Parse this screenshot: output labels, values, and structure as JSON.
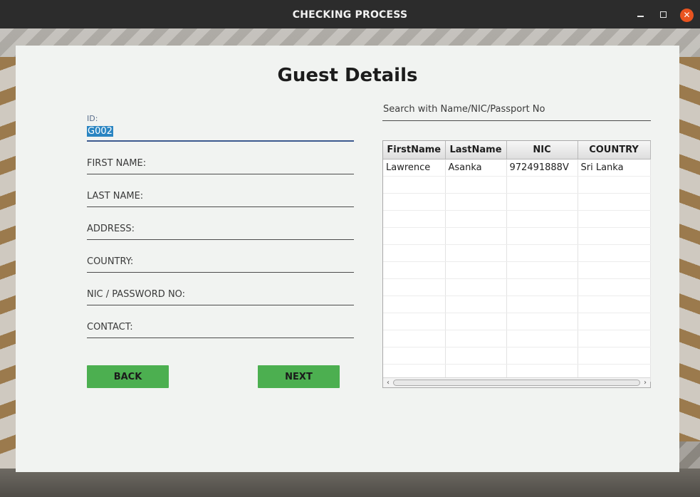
{
  "window": {
    "title": "CHECKING PROCESS",
    "close_glyph": "✕"
  },
  "page": {
    "heading": "Guest Details"
  },
  "form": {
    "id_label": "ID:",
    "id_value": "G002",
    "first_name_label": "FIRST NAME:",
    "last_name_label": "LAST NAME:",
    "address_label": "ADDRESS:",
    "country_label": "COUNTRY:",
    "nic_label": "NIC / PASSWORD NO:",
    "contact_label": "CONTACT:"
  },
  "buttons": {
    "back": "BACK",
    "next": "NEXT"
  },
  "search": {
    "placeholder": "Search  with Name/NIC/Passport No"
  },
  "table": {
    "headers": [
      "FirstName",
      "LastName",
      "NIC",
      "COUNTRY"
    ],
    "rows": [
      [
        "Lawrence",
        "Asanka",
        "972491888V",
        "Sri Lanka"
      ]
    ]
  },
  "icons": {
    "minimize": "minimize-icon",
    "maximize": "maximize-icon",
    "close": "close-icon",
    "scroll_left": "chevron-left-icon",
    "scroll_right": "chevron-right-icon"
  },
  "colors": {
    "accent_button": "#4caf50",
    "close_button": "#e95420",
    "selection": "#2a85c2"
  }
}
